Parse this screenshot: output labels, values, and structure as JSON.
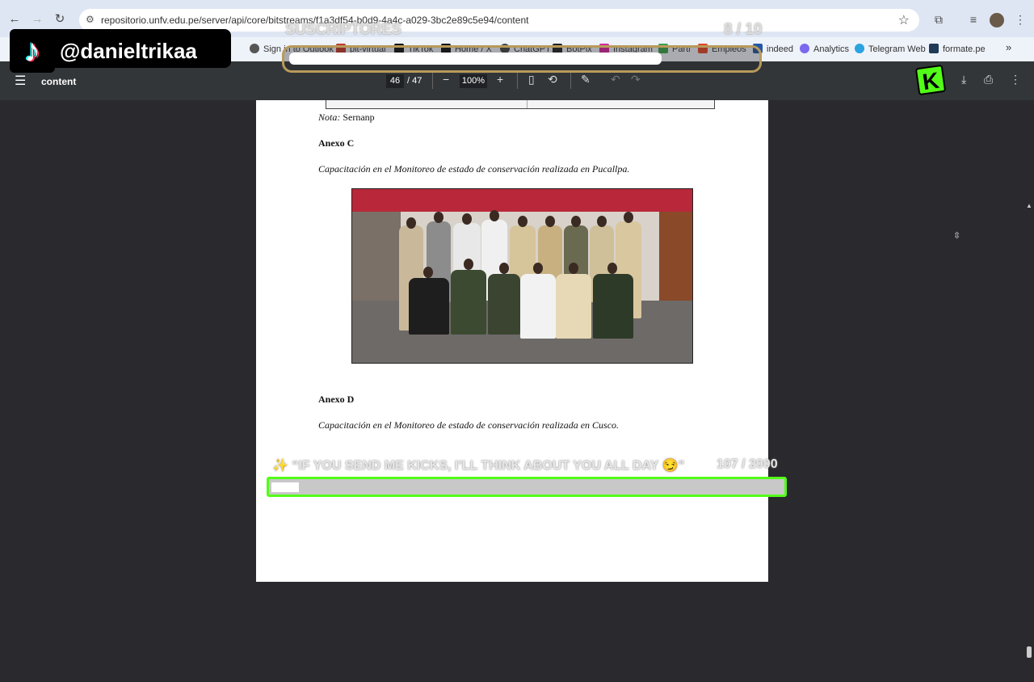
{
  "browser": {
    "url": "repositorio.unfv.edu.pe/server/api/core/bitstreams/f1a3df54-b0d9-4a4c-a029-3bc2e89c5e94/content",
    "bookmarks": [
      {
        "label": "Sign in to Outlook",
        "color": "#555"
      },
      {
        "label": "pit-virtual",
        "color": "#c0392b"
      },
      {
        "label": "TikTok",
        "color": "#111"
      },
      {
        "label": "Home / X",
        "color": "#111"
      },
      {
        "label": "ChatGPT",
        "color": "#444"
      },
      {
        "label": "BotPix",
        "color": "#222"
      },
      {
        "label": "Instagram",
        "color": "#d6249f"
      },
      {
        "label": "Parti",
        "color": "#3aa14c"
      },
      {
        "label": "Empleos",
        "color": "#e0452b"
      },
      {
        "label": "indeed",
        "color": "#2557a7"
      },
      {
        "label": "Analytics",
        "color": "#7b68ee"
      },
      {
        "label": "Telegram Web",
        "color": "#2aa3df"
      },
      {
        "label": "formate.pe",
        "color": "#1f3b57"
      }
    ],
    "more_bookmarks": "»"
  },
  "pdf": {
    "title": "content",
    "current_page": "46",
    "total_pages": "/ 47",
    "zoom": "100%",
    "zoom_out": "−",
    "zoom_in": "+"
  },
  "document": {
    "nota_label": "Nota:",
    "nota_value": "Sernanp",
    "anexo_c": "Anexo C",
    "caption_c": "Capacitación en el Monitoreo de estado de conservación realizada en Pucallpa.",
    "anexo_d": "Anexo D",
    "caption_d": "Capacitación en el Monitoreo de estado de conservación realizada en Cusco."
  },
  "overlay": {
    "tiktok_handle": "@danieltrikaa",
    "subs_label": "SUSCRIPTORES",
    "subs_count": "8 / 10",
    "subs_progress": 0.8,
    "kick_logo": "K",
    "kick_message": "✨ “IF YOU SEND ME KICKS, I’LL THINK ABOUT YOU ALL DAY 😏”",
    "kick_count": "107 / 2000",
    "kick_progress": 0.0535,
    "kick_color": "#53fc18"
  }
}
